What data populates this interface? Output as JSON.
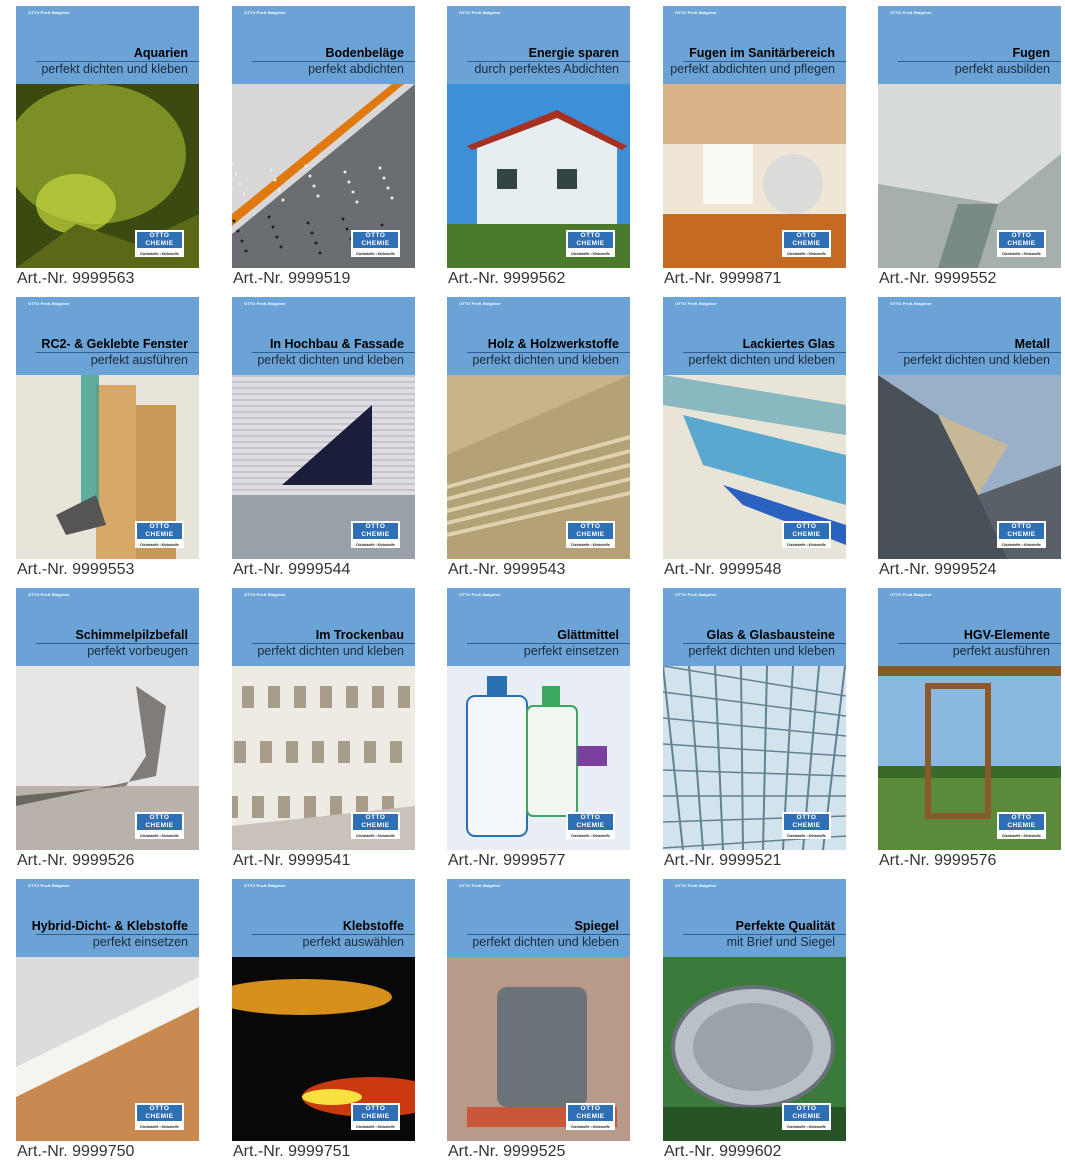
{
  "brochures": [
    {
      "series": "OTTO Profi-Ratgeber",
      "title": "Aquarien",
      "subtitle": "perfekt dichten und kleben",
      "art_nr": "Art.-Nr. 9999563",
      "logo_top": "OTTO",
      "logo_mid": "CHEMIE",
      "logo_tag": "Dichtstoffe • Klebstoffe",
      "photo": "aquarium-photo",
      "palette": [
        "#8ca02a",
        "#3a4a10",
        "#c8d840"
      ]
    },
    {
      "series": "OTTO Profi-Ratgeber",
      "title": "Bodenbeläge",
      "subtitle": "perfekt abdichten",
      "art_nr": "Art.-Nr. 9999519",
      "logo_top": "OTTO",
      "logo_mid": "CHEMIE",
      "logo_tag": "Dichtstoffe • Klebstoffe",
      "photo": "floor-terrazzo-photo",
      "palette": [
        "#d8d8d8",
        "#6a6e72",
        "#e07a10"
      ]
    },
    {
      "series": "OTTO Profi-Ratgeber",
      "title": "Energie sparen",
      "subtitle": "durch perfektes Abdichten",
      "art_nr": "Art.-Nr. 9999562",
      "logo_top": "OTTO",
      "logo_mid": "CHEMIE",
      "logo_tag": "Dichtstoffe • Klebstoffe",
      "photo": "house-photo",
      "palette": [
        "#3d8fd8",
        "#e6eef2",
        "#4a7a2a"
      ]
    },
    {
      "series": "OTTO Profi-Ratgeber",
      "title": "Fugen im Sanitärbereich",
      "subtitle": "perfekt abdichten und pflegen",
      "art_nr": "Art.-Nr. 9999871",
      "logo_top": "OTTO",
      "logo_mid": "CHEMIE",
      "logo_tag": "Dichtstoffe • Klebstoffe",
      "photo": "bathroom-photo",
      "palette": [
        "#d9b48a",
        "#c46a22",
        "#f0e6d8"
      ]
    },
    {
      "series": "OTTO Profi-Ratgeber",
      "title": "Fugen",
      "subtitle": "perfekt ausbilden",
      "art_nr": "Art.-Nr. 9999552",
      "logo_top": "OTTO",
      "logo_mid": "CHEMIE",
      "logo_tag": "Dichtstoffe • Klebstoffe",
      "photo": "joint-photo",
      "palette": [
        "#d8dcd8",
        "#7a8a84",
        "#a6b0aa"
      ]
    },
    {
      "series": "OTTO Profi-Ratgeber",
      "title": "RC2- & Geklebte Fenster",
      "subtitle": "perfekt ausführen",
      "art_nr": "Art.-Nr. 9999553",
      "logo_top": "OTTO",
      "logo_mid": "CHEMIE",
      "logo_tag": "Dichtstoffe • Klebstoffe",
      "photo": "window-frame-photo",
      "palette": [
        "#e8e4da",
        "#d8a868",
        "#3aa090"
      ]
    },
    {
      "series": "OTTO Profi-Ratgeber",
      "title": "In Hochbau & Fassade",
      "subtitle": "perfekt dichten und kleben",
      "art_nr": "Art.-Nr. 9999544",
      "logo_top": "OTTO",
      "logo_mid": "CHEMIE",
      "logo_tag": "Dichtstoffe • Klebstoffe",
      "photo": "facade-photo",
      "palette": [
        "#e0dce4",
        "#1a1e3a",
        "#9aa0a8"
      ]
    },
    {
      "series": "OTTO Profi-Ratgeber",
      "title": "Holz & Holzwerkstoffe",
      "subtitle": "perfekt dichten und kleben",
      "art_nr": "Art.-Nr. 9999543",
      "logo_top": "OTTO",
      "logo_mid": "CHEMIE",
      "logo_tag": "Dichtstoffe • Klebstoffe",
      "photo": "wood-panels-photo",
      "palette": [
        "#c8b488",
        "#a8946a",
        "#e0d2b0"
      ]
    },
    {
      "series": "OTTO Profi-Ratgeber",
      "title": "Lackiertes Glas",
      "subtitle": "perfekt dichten und kleben",
      "art_nr": "Art.-Nr. 9999548",
      "logo_top": "OTTO",
      "logo_mid": "CHEMIE",
      "logo_tag": "Dichtstoffe • Klebstoffe",
      "photo": "painted-glass-photo",
      "palette": [
        "#5aa8d0",
        "#e8e4d8",
        "#8ab8c0"
      ]
    },
    {
      "series": "OTTO Profi-Ratgeber",
      "title": "Metall",
      "subtitle": "perfekt dichten und kleben",
      "art_nr": "Art.-Nr. 9999524",
      "logo_top": "OTTO",
      "logo_mid": "CHEMIE",
      "logo_tag": "Dichtstoffe • Klebstoffe",
      "photo": "metal-corner-photo",
      "palette": [
        "#9ab0c8",
        "#4a5058",
        "#c8b898"
      ]
    },
    {
      "series": "OTTO Profi-Ratgeber",
      "title": "Schimmelpilzbefall",
      "subtitle": "perfekt vorbeugen",
      "art_nr": "Art.-Nr. 9999526",
      "logo_top": "OTTO",
      "logo_mid": "CHEMIE",
      "logo_tag": "Dichtstoffe • Klebstoffe",
      "photo": "mold-photo",
      "palette": [
        "#e8e6e4",
        "#3a3632",
        "#b8b2aa"
      ]
    },
    {
      "series": "OTTO Profi-Ratgeber",
      "title": "Im Trockenbau",
      "subtitle": "perfekt dichten und kleben",
      "art_nr": "Art.-Nr. 9999541",
      "logo_top": "OTTO",
      "logo_mid": "CHEMIE",
      "logo_tag": "Dichtstoffe • Klebstoffe",
      "photo": "drywall-photo",
      "palette": [
        "#eeeae4",
        "#a89c8a",
        "#c8c2ba"
      ]
    },
    {
      "series": "OTTO Profi-Ratgeber",
      "title": "Glättmittel",
      "subtitle": "perfekt einsetzen",
      "art_nr": "Art.-Nr. 9999577",
      "logo_top": "OTTO",
      "logo_mid": "CHEMIE",
      "logo_tag": "Dichtstoffe • Klebstoffe",
      "photo": "bottles-photo",
      "palette": [
        "#e8eef4",
        "#2a70b0",
        "#3aa860"
      ]
    },
    {
      "series": "OTTO Profi-Ratgeber",
      "title": "Glas & Glasbausteine",
      "subtitle": "perfekt dichten und kleben",
      "art_nr": "Art.-Nr. 9999521",
      "logo_top": "OTTO",
      "logo_mid": "CHEMIE",
      "logo_tag": "Dichtstoffe • Klebstoffe",
      "photo": "glass-roof-photo",
      "palette": [
        "#9ac0d8",
        "#eaf2f6",
        "#4a6878"
      ]
    },
    {
      "series": "OTTO Profi-Ratgeber",
      "title": "HGV-Elemente",
      "subtitle": "perfekt ausführen",
      "art_nr": "Art.-Nr. 9999576",
      "logo_top": "OTTO",
      "logo_mid": "CHEMIE",
      "logo_tag": "Dichtstoffe • Klebstoffe",
      "photo": "landscape-window-photo",
      "palette": [
        "#8ab8e0",
        "#5a8a3a",
        "#8a5a2a"
      ]
    },
    {
      "series": "OTTO Profi-Ratgeber",
      "title": "Hybrid-Dicht- & Klebstoffe",
      "subtitle": "perfekt einsetzen",
      "art_nr": "Art.-Nr. 9999750",
      "logo_top": "OTTO",
      "logo_mid": "CHEMIE",
      "logo_tag": "Dichtstoffe • Klebstoffe",
      "photo": "hybrid-sealant-photo",
      "palette": [
        "#dcdcdc",
        "#f4f4f0",
        "#c88a50"
      ]
    },
    {
      "series": "OTTO Profi-Ratgeber",
      "title": "Klebstoffe",
      "subtitle": "perfekt auswählen",
      "art_nr": "Art.-Nr. 9999751",
      "logo_top": "OTTO",
      "logo_mid": "CHEMIE",
      "logo_tag": "Dichtstoffe • Klebstoffe",
      "photo": "stress-optics-photo",
      "palette": [
        "#080808",
        "#f0a020",
        "#e04010"
      ]
    },
    {
      "series": "OTTO Profi-Ratgeber",
      "title": "Spiegel",
      "subtitle": "perfekt dichten und kleben",
      "art_nr": "Art.-Nr. 9999525",
      "logo_top": "OTTO",
      "logo_mid": "CHEMIE",
      "logo_tag": "Dichtstoffe • Klebstoffe",
      "photo": "mirror-photo",
      "palette": [
        "#b89a8a",
        "#6a7478",
        "#c8583a"
      ]
    },
    {
      "series": "OTTO Profi-Ratgeber",
      "title": "Perfekte Qualität",
      "subtitle": "mit Brief und Siegel",
      "art_nr": "Art.-Nr. 9999602",
      "logo_top": "OTTO",
      "logo_mid": "CHEMIE",
      "logo_tag": "Dichtstoffe • Klebstoffe",
      "photo": "quality-seal-photo",
      "palette": [
        "#3a7a3a",
        "#1a3a1a",
        "#b8c0c8"
      ]
    }
  ]
}
